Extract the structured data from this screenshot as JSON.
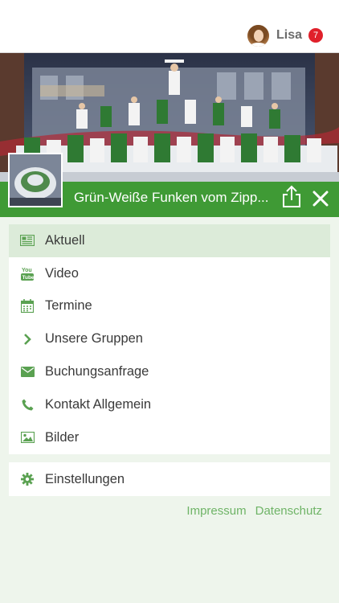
{
  "user": {
    "name": "Lisa",
    "notification_count": "7"
  },
  "group": {
    "title": "Grün-Weiße Funken vom Zipp..."
  },
  "menu": {
    "items": [
      {
        "label": "Aktuell",
        "icon": "newspaper-icon",
        "active": true
      },
      {
        "label": "Video",
        "icon": "youtube-icon"
      },
      {
        "label": "Termine",
        "icon": "calendar-icon"
      },
      {
        "label": "Unsere Gruppen",
        "icon": "chevron-right-icon"
      },
      {
        "label": "Buchungsanfrage",
        "icon": "envelope-icon"
      },
      {
        "label": "Kontakt Allgemein",
        "icon": "phone-icon"
      },
      {
        "label": "Bilder",
        "icon": "image-icon"
      }
    ],
    "settings_label": "Einstellungen"
  },
  "footer": {
    "impressum": "Impressum",
    "datenschutz": "Datenschutz"
  },
  "colors": {
    "accent": "#3f9a35",
    "accent_light": "#6fb467",
    "active_bg": "#dcebd9",
    "badge": "#e0202a",
    "page_bg": "#eef5ec"
  }
}
